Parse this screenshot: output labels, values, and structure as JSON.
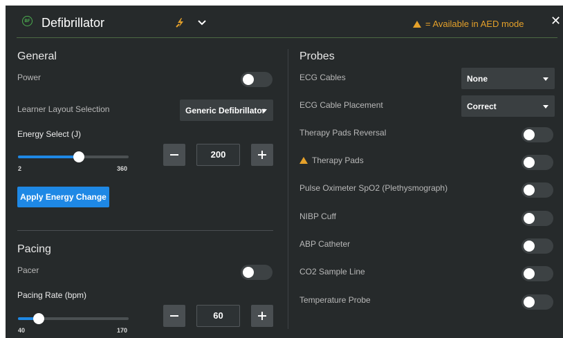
{
  "header": {
    "logo_text": "BF",
    "title": "Defibrillator",
    "legend": "= Available in AED mode",
    "close": "✕",
    "icons": [
      "plug-bolt-icon",
      "chevron-down-icon",
      "warning-triangle-icon",
      "close-icon"
    ],
    "accent_color": "#e5a12a"
  },
  "general": {
    "heading": "General",
    "power_label": "Power",
    "power_on": false,
    "layout_label": "Learner Layout Selection",
    "layout_value": "Generic Defibrillator",
    "energy_label": "Energy Select (J)",
    "energy_min": "2",
    "energy_max": "360",
    "energy_value": "200",
    "apply_label": "Apply Energy Change"
  },
  "pacing": {
    "heading": "Pacing",
    "pacer_label": "Pacer",
    "pacer_on": false,
    "rate_label": "Pacing Rate (bpm)",
    "rate_min": "40",
    "rate_max": "170",
    "rate_value": "60"
  },
  "probes": {
    "heading": "Probes",
    "ecg_cables_label": "ECG Cables",
    "ecg_cables_value": "None",
    "ecg_placement_label": "ECG Cable Placement",
    "ecg_placement_value": "Correct",
    "items": [
      {
        "label": "Therapy Pads Reversal",
        "aed": false,
        "on": false
      },
      {
        "label": "Therapy Pads",
        "aed": true,
        "on": false
      },
      {
        "label": "Pulse Oximeter SpO2 (Plethysmograph)",
        "aed": false,
        "on": false
      },
      {
        "label": "NIBP Cuff",
        "aed": false,
        "on": false
      },
      {
        "label": "ABP Catheter",
        "aed": false,
        "on": false
      },
      {
        "label": "CO2 Sample Line",
        "aed": false,
        "on": false
      },
      {
        "label": "Temperature Probe",
        "aed": false,
        "on": false
      }
    ]
  }
}
